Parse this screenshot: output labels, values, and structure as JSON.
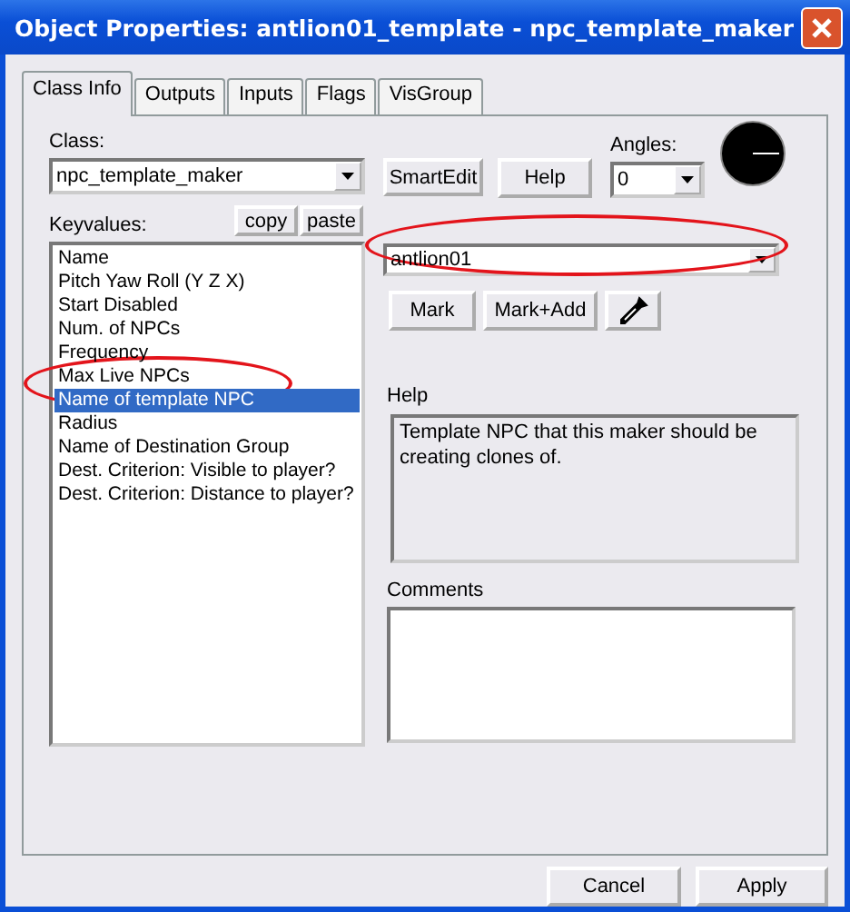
{
  "window": {
    "title": "Object Properties: antlion01_template - npc_template_maker"
  },
  "tabs": [
    {
      "label": "Class Info",
      "selected": true
    },
    {
      "label": "Outputs",
      "selected": false
    },
    {
      "label": "Inputs",
      "selected": false
    },
    {
      "label": "Flags",
      "selected": false
    },
    {
      "label": "VisGroup",
      "selected": false
    }
  ],
  "class": {
    "label": "Class:",
    "value": "npc_template_maker"
  },
  "smartedit": {
    "label": "SmartEdit",
    "on": false
  },
  "help_button": "Help",
  "angles": {
    "label": "Angles:",
    "value": "0"
  },
  "keyvalues": {
    "label": "Keyvalues:",
    "copy": "copy",
    "paste": "paste",
    "items": [
      {
        "label": "Name",
        "selected": false
      },
      {
        "label": "Pitch Yaw Roll (Y Z X)",
        "selected": false
      },
      {
        "label": "Start Disabled",
        "selected": false
      },
      {
        "label": "Num. of NPCs",
        "selected": false
      },
      {
        "label": "Frequency",
        "selected": false
      },
      {
        "label": "Max Live NPCs",
        "selected": false
      },
      {
        "label": "Name of template NPC",
        "selected": true
      },
      {
        "label": "Radius",
        "selected": false
      },
      {
        "label": "Name of Destination Group",
        "selected": false
      },
      {
        "label": "Dest. Criterion: Visible to player?",
        "selected": false
      },
      {
        "label": "Dest. Criterion: Distance to player?",
        "selected": false
      }
    ]
  },
  "value": "antlion01",
  "mark_buttons": [
    "Mark",
    "Mark+Add"
  ],
  "help": {
    "label": "Help",
    "text": "Template NPC that this maker should be creating clones of."
  },
  "comments": {
    "label": "Comments"
  },
  "buttons": [
    "Cancel",
    "Apply"
  ]
}
